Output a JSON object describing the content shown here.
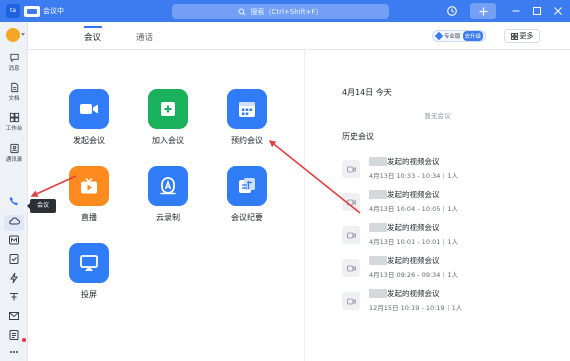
{
  "window": {
    "logo_text": "ta",
    "app_title": "会议中",
    "search_placeholder": "搜索（Ctrl+Shift+F）"
  },
  "sidebar": {
    "items": [
      {
        "label": "消息",
        "icon": "chat-bubble-icon"
      },
      {
        "label": "文档",
        "icon": "document-icon"
      },
      {
        "label": "工作台",
        "icon": "workbench-grid-icon"
      },
      {
        "label": "通讯录",
        "icon": "contacts-icon"
      }
    ],
    "tooltip": "会议"
  },
  "tabs": [
    {
      "label": "会议",
      "active": true
    },
    {
      "label": "通话",
      "active": false
    }
  ],
  "header": {
    "pro_text": "专业版",
    "upgrade_label": "去升级",
    "more_label": "更多"
  },
  "apps": [
    {
      "label": "发起会议",
      "color": "#2f7cf6",
      "icon": "video-camera-icon"
    },
    {
      "label": "加入会议",
      "color": "#19b15c",
      "icon": "plus-square-icon"
    },
    {
      "label": "预约会议",
      "color": "#2f7cf6",
      "icon": "calendar-icon"
    },
    {
      "label": "直播",
      "color": "#ff8a1f",
      "icon": "tv-live-icon"
    },
    {
      "label": "云录制",
      "color": "#2f7cf6",
      "icon": "cloud-record-icon"
    },
    {
      "label": "会议纪要",
      "color": "#2f7cf6",
      "icon": "meeting-notes-icon"
    },
    {
      "label": "投屏",
      "color": "#2f7cf6",
      "icon": "screen-cast-icon"
    }
  ],
  "schedule": {
    "date": "4月14日 今天",
    "empty_text": "暂无会议",
    "history_title": "历史会议"
  },
  "history": [
    {
      "title": "发起的视频会议",
      "time": "4月13日 10:33 - 10:34",
      "count": "1人"
    },
    {
      "title": "发起的视频会议",
      "time": "4月13日 10:04 - 10:05",
      "count": "1人"
    },
    {
      "title": "发起的视频会议",
      "time": "4月13日 10:01 - 10:01",
      "count": "1人"
    },
    {
      "title": "发起的视频会议",
      "time": "4月13日 09:26 - 09:34",
      "count": "1人"
    },
    {
      "title": "发起的视频会议",
      "time": "12月15日 10:19 - 10:19",
      "count": "1人"
    }
  ],
  "colors": {
    "brand_blue": "#3d7cf0",
    "annotation_red": "#e04040",
    "live_orange": "#ff8a1f",
    "join_green": "#19b15c"
  }
}
